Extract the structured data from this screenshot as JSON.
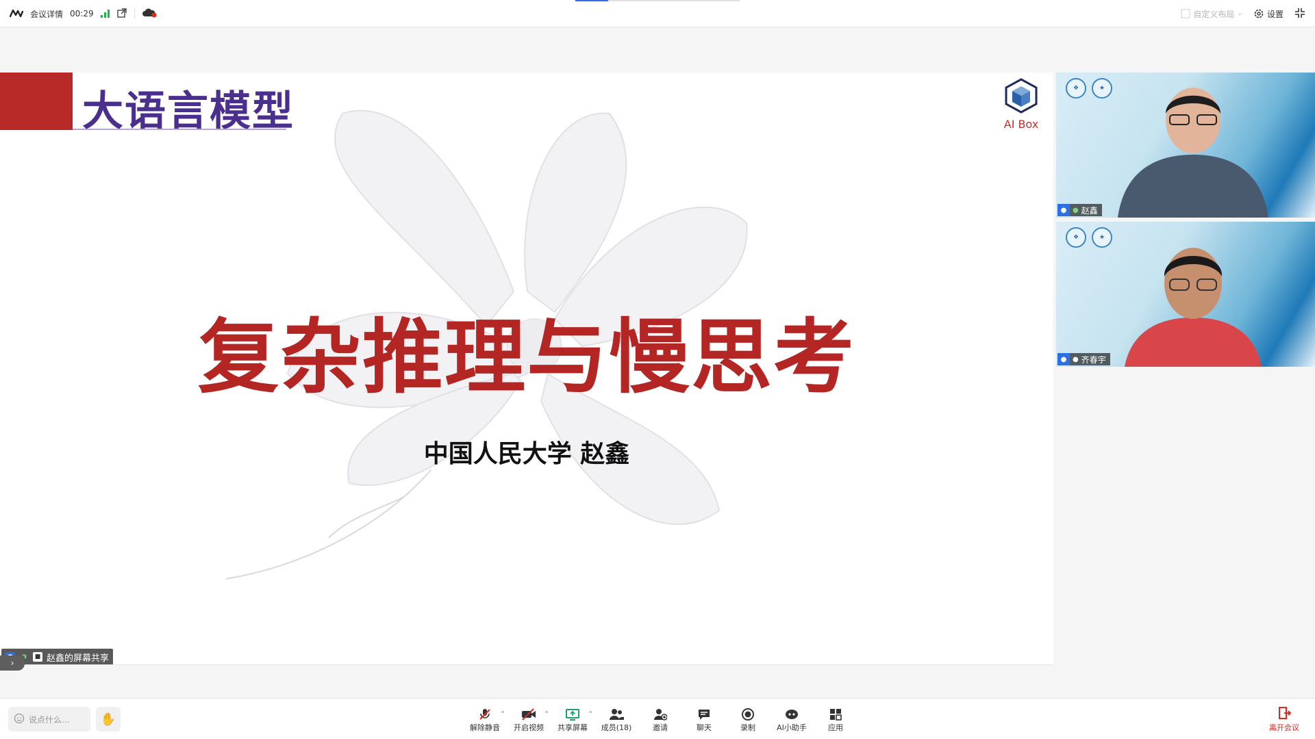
{
  "topbar": {
    "meeting_details": "会议详情",
    "timer": "00:29",
    "custom_layout": "自定义布局",
    "settings": "设置",
    "window_progress": 0.2
  },
  "slide": {
    "header_title": "大语言模型",
    "main_title": "复杂推理与慢思考",
    "subtitle": "中国人民大学 赵鑫",
    "logo_text": "AI Box"
  },
  "share_tag": {
    "label": "赵鑫的屏幕共享"
  },
  "participants": [
    {
      "name": "赵鑫"
    },
    {
      "name": "齐春宇"
    }
  ],
  "bottombar": {
    "chat_placeholder": "说点什么...",
    "tools": [
      {
        "label": "解除静音",
        "icon": "mic-muted-icon"
      },
      {
        "label": "开启视频",
        "icon": "video-off-icon"
      },
      {
        "label": "共享屏幕",
        "icon": "share-screen-icon"
      },
      {
        "label": "成员(18)",
        "icon": "members-icon"
      },
      {
        "label": "邀请",
        "icon": "invite-icon"
      },
      {
        "label": "聊天",
        "icon": "chat-icon"
      },
      {
        "label": "录制",
        "icon": "record-icon"
      },
      {
        "label": "AI小助手",
        "icon": "ai-assistant-icon"
      },
      {
        "label": "应用",
        "icon": "apps-icon"
      }
    ],
    "leave": "离开会议"
  },
  "colors": {
    "slide_red": "#b32623",
    "slide_purple": "#4b2f8f",
    "accent_blue": "#2f6fe4",
    "signal_green": "#22b14c",
    "leave_red": "#e0281f"
  }
}
